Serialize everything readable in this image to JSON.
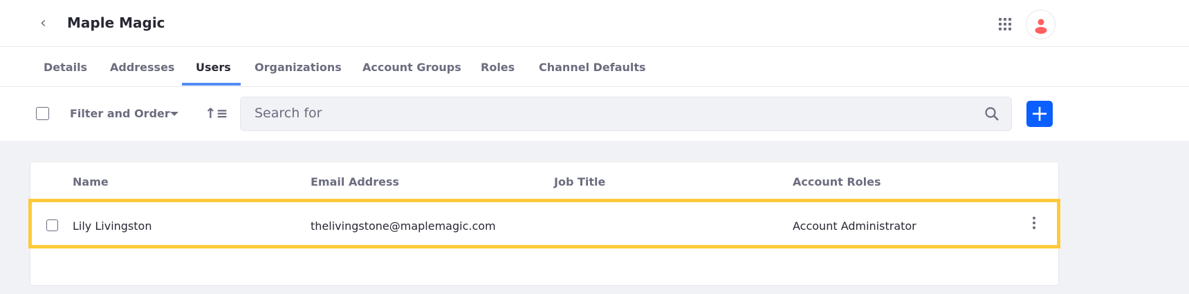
{
  "header": {
    "title": "Maple Magic"
  },
  "tabs": [
    "Details",
    "Addresses",
    "Users",
    "Organizations",
    "Account Groups",
    "Roles",
    "Channel Defaults"
  ],
  "active_tab": "Users",
  "toolbar": {
    "filter_label": "Filter and Order",
    "search_placeholder": "Search for",
    "add_icon": "plus-icon"
  },
  "table": {
    "columns": [
      "Name",
      "Email Address",
      "Job Title",
      "Account Roles"
    ],
    "rows": [
      {
        "name": "Lily Livingston",
        "email": "thelivingstone@maplemagic.com",
        "job_title": "",
        "roles": "Account Administrator"
      }
    ]
  },
  "colors": {
    "accent": "#0b5fff",
    "tab_indicator": "#528af5",
    "highlight": "#ffca3a",
    "avatar": "#ff5f5f"
  }
}
